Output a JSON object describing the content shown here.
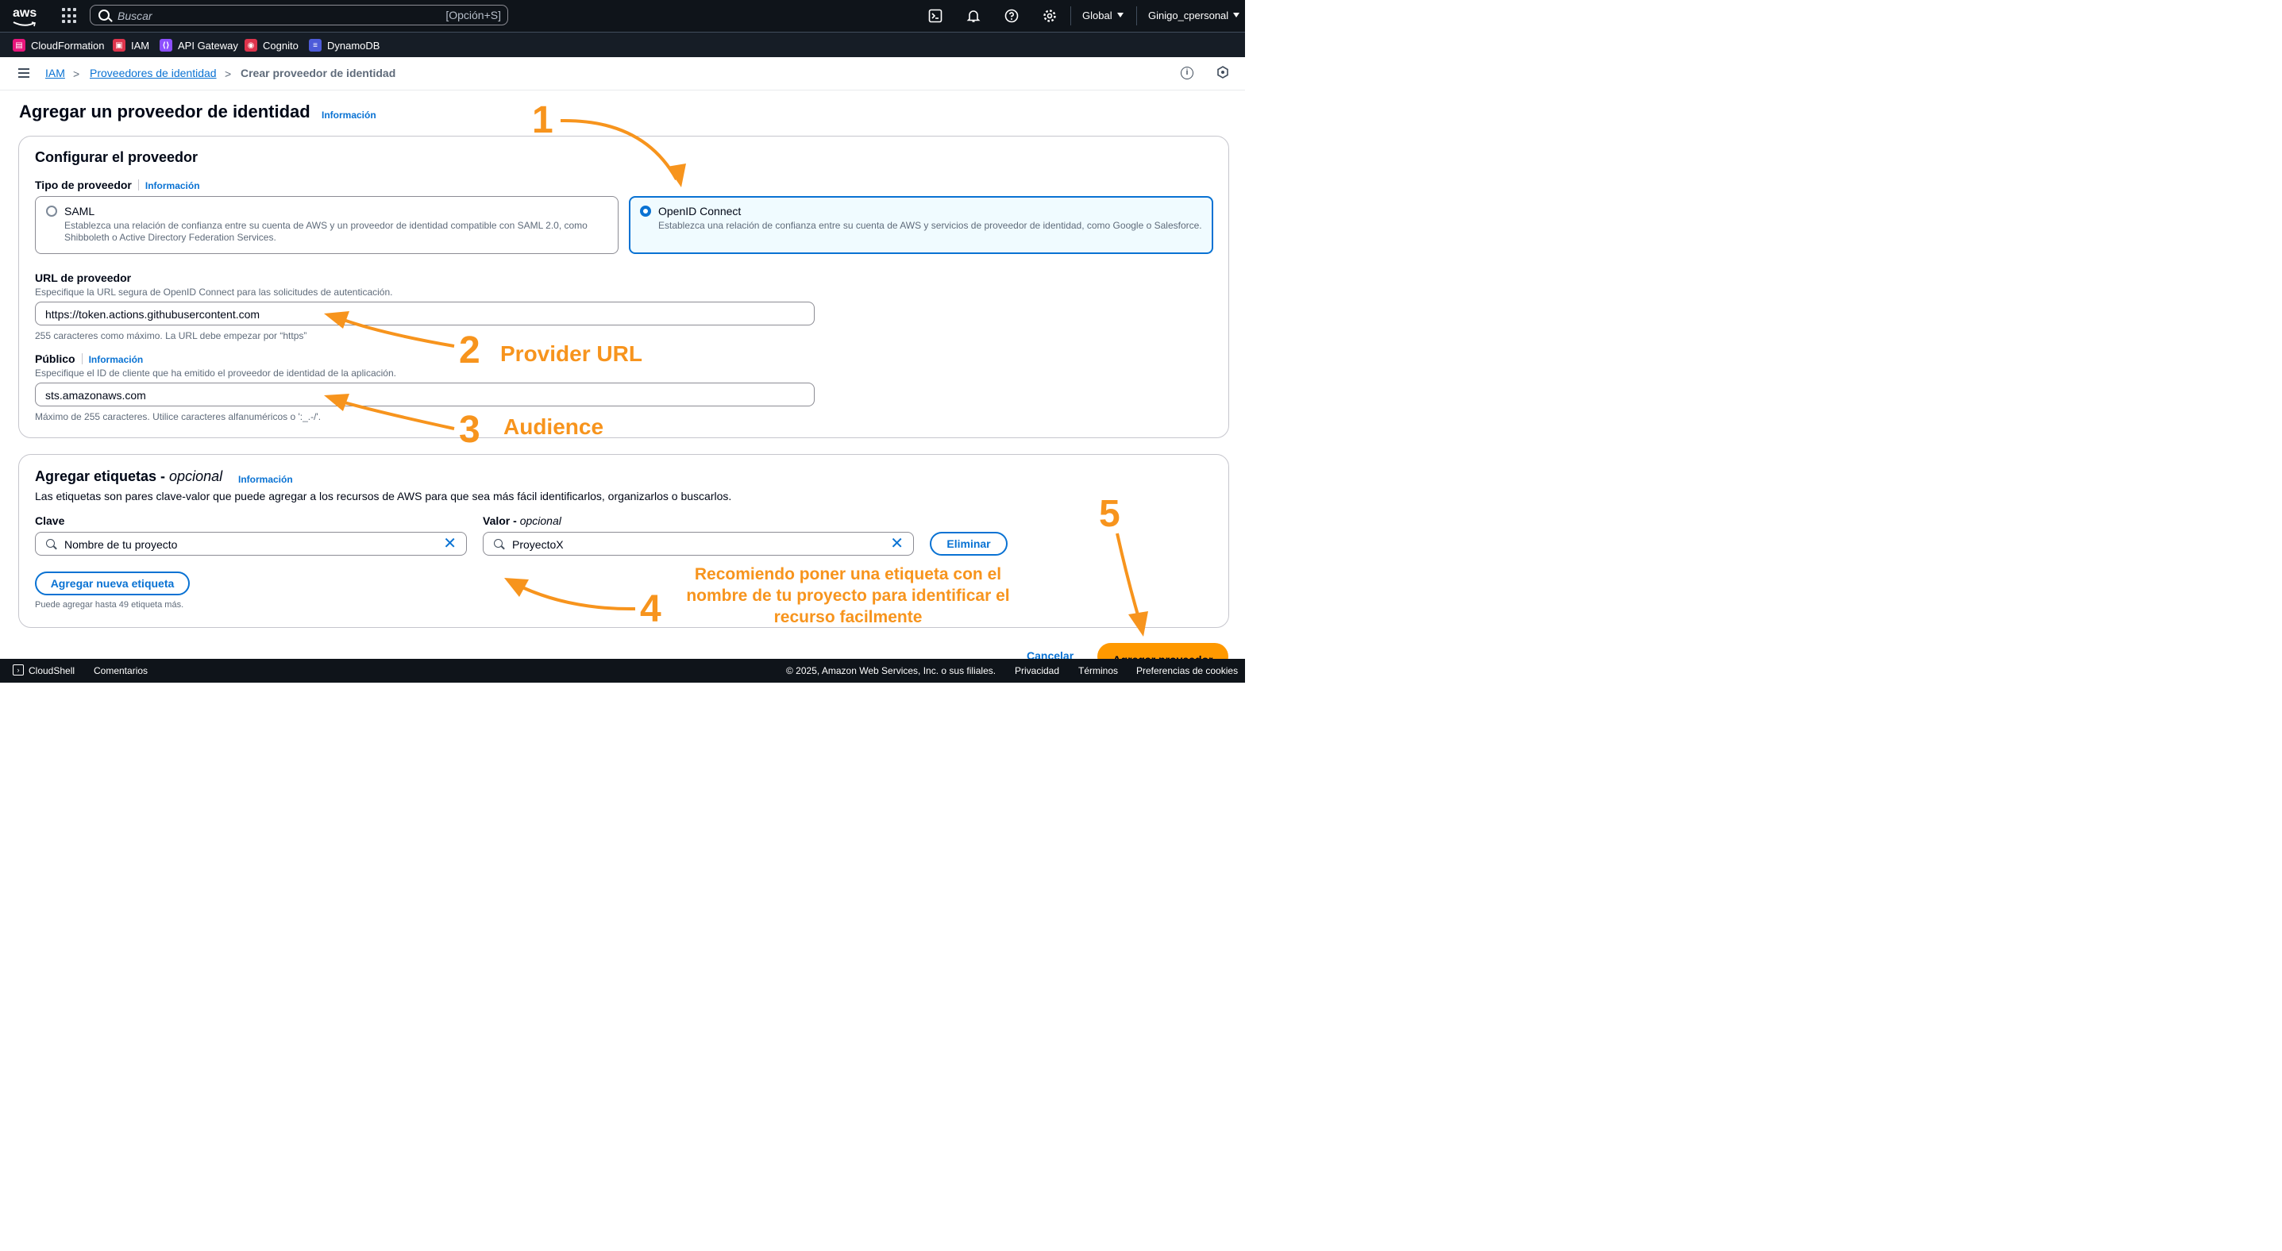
{
  "topnav": {
    "logo": "aws",
    "search_placeholder": "Buscar",
    "search_shortcut": "[Opción+S]",
    "region": "Global",
    "account": "Ginigo_cpersonal"
  },
  "favorites": [
    {
      "label": "CloudFormation",
      "color": "#e7157b"
    },
    {
      "label": "IAM",
      "color": "#dd344c"
    },
    {
      "label": "API Gateway",
      "color": "#8c4fff"
    },
    {
      "label": "Cognito",
      "color": "#dd344c"
    },
    {
      "label": "DynamoDB",
      "color": "#4d5bd9"
    }
  ],
  "breadcrumb": {
    "items": [
      "IAM",
      "Proveedores de identidad",
      "Crear proveedor de identidad"
    ]
  },
  "page": {
    "title": "Agregar un proveedor de identidad",
    "info": "Información"
  },
  "configure": {
    "title": "Configurar el proveedor",
    "provider_type_label": "Tipo de proveedor",
    "provider_type_info": "Información",
    "saml_title": "SAML",
    "saml_desc_1": "Establezca una relación de confianza entre su cuenta de AWS y un proveedor de identidad compatible con SAML 2.0, como",
    "saml_desc_2": "Shibboleth o Active Directory Federation Services.",
    "oidc_title": "OpenID Connect",
    "oidc_desc": "Establezca una relación de confianza entre su cuenta de AWS y servicios de proveedor de identidad, como Google o Salesforce.",
    "selected": "OpenID Connect",
    "url_label": "URL de proveedor",
    "url_desc": "Especifique la URL segura de OpenID Connect para las solicitudes de autenticación.",
    "url_value": "https://token.actions.githubusercontent.com",
    "url_hint": "255 caracteres como máximo. La URL debe empezar por “https”",
    "audience_label": "Público",
    "audience_info": "Información",
    "audience_desc": "Especifique el ID de cliente que ha emitido el proveedor de identidad de la aplicación.",
    "audience_value": "sts.amazonaws.com",
    "audience_hint": "Máximo de 255 caracteres. Utilice caracteres alfanuméricos o ':_.-/'."
  },
  "tags": {
    "title": "Agregar etiquetas - ",
    "title_optional": "opcional",
    "info": "Información",
    "desc": "Las etiquetas son pares clave-valor que puede agregar a los recursos de AWS para que sea más fácil identificarlos, organizarlos o buscarlos.",
    "key_label": "Clave",
    "value_label": "Valor - ",
    "value_optional": "opcional",
    "key_value": "Nombre de tu proyecto",
    "value_value": "ProyectoX",
    "remove_button": "Eliminar",
    "add_button": "Agregar nueva etiqueta",
    "hint": "Puede agregar hasta 49 etiqueta más."
  },
  "actions": {
    "cancel": "Cancelar",
    "submit": "Agregar proveedor"
  },
  "footer": {
    "cloudshell": "CloudShell",
    "comments": "Comentarios",
    "copyright": "© 2025, Amazon Web Services, Inc. o sus filiales.",
    "privacy": "Privacidad",
    "terms": "Términos",
    "cookies": "Preferencias de cookies"
  },
  "annotations": {
    "n1": "1",
    "n2": "2",
    "n3": "3",
    "n4": "4",
    "n5": "5",
    "provider_url": "Provider URL",
    "audience": "Audience",
    "tip_line1": "Recomiendo poner una etiqueta con el",
    "tip_line2": "nombre de tu proyecto para identificar el",
    "tip_line3": "recurso facilmente",
    "color": "#f7941d"
  }
}
